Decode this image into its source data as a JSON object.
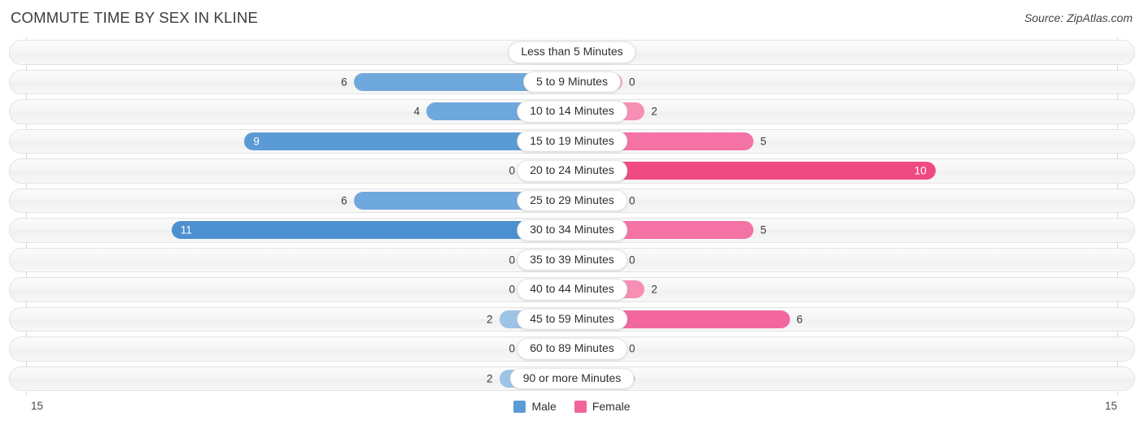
{
  "header": {
    "title": "COMMUTE TIME BY SEX IN KLINE",
    "source": "Source: ZipAtlas.com"
  },
  "legend": {
    "male_label": "Male",
    "female_label": "Female",
    "male_color": "#5b9bd5",
    "female_color": "#f2649a"
  },
  "axis": {
    "left_max_label": "15",
    "right_max_label": "15",
    "max": 15
  },
  "chart_data": {
    "type": "bar",
    "subtype": "diverging-population-pyramid",
    "title": "COMMUTE TIME BY SEX IN KLINE",
    "xlabel": "",
    "ylabel": "",
    "xlim": [
      15,
      15
    ],
    "grid": false,
    "legend_position": "bottom-center",
    "categories": [
      "Less than 5 Minutes",
      "5 to 9 Minutes",
      "10 to 14 Minutes",
      "15 to 19 Minutes",
      "20 to 24 Minutes",
      "25 to 29 Minutes",
      "30 to 34 Minutes",
      "35 to 39 Minutes",
      "40 to 44 Minutes",
      "45 to 59 Minutes",
      "60 to 89 Minutes",
      "90 or more Minutes"
    ],
    "series": [
      {
        "name": "Male",
        "side": "left",
        "color": "#5b9bd5",
        "values": [
          0,
          6,
          4,
          9,
          0,
          6,
          11,
          0,
          0,
          2,
          0,
          2
        ]
      },
      {
        "name": "Female",
        "side": "right",
        "color": "#f2649a",
        "values": [
          0,
          0,
          2,
          5,
          10,
          0,
          5,
          0,
          2,
          6,
          0,
          0
        ]
      }
    ]
  },
  "rows": [
    {
      "label": "Less than 5 Minutes",
      "male": "0",
      "female": "0"
    },
    {
      "label": "5 to 9 Minutes",
      "male": "6",
      "female": "0"
    },
    {
      "label": "10 to 14 Minutes",
      "male": "4",
      "female": "2"
    },
    {
      "label": "15 to 19 Minutes",
      "male": "9",
      "female": "5"
    },
    {
      "label": "20 to 24 Minutes",
      "male": "0",
      "female": "10"
    },
    {
      "label": "25 to 29 Minutes",
      "male": "6",
      "female": "0"
    },
    {
      "label": "30 to 34 Minutes",
      "male": "11",
      "female": "5"
    },
    {
      "label": "35 to 39 Minutes",
      "male": "0",
      "female": "0"
    },
    {
      "label": "40 to 44 Minutes",
      "male": "0",
      "female": "2"
    },
    {
      "label": "45 to 59 Minutes",
      "male": "2",
      "female": "6"
    },
    {
      "label": "60 to 89 Minutes",
      "male": "0",
      "female": "0"
    },
    {
      "label": "90 or more Minutes",
      "male": "2",
      "female": "0"
    }
  ]
}
